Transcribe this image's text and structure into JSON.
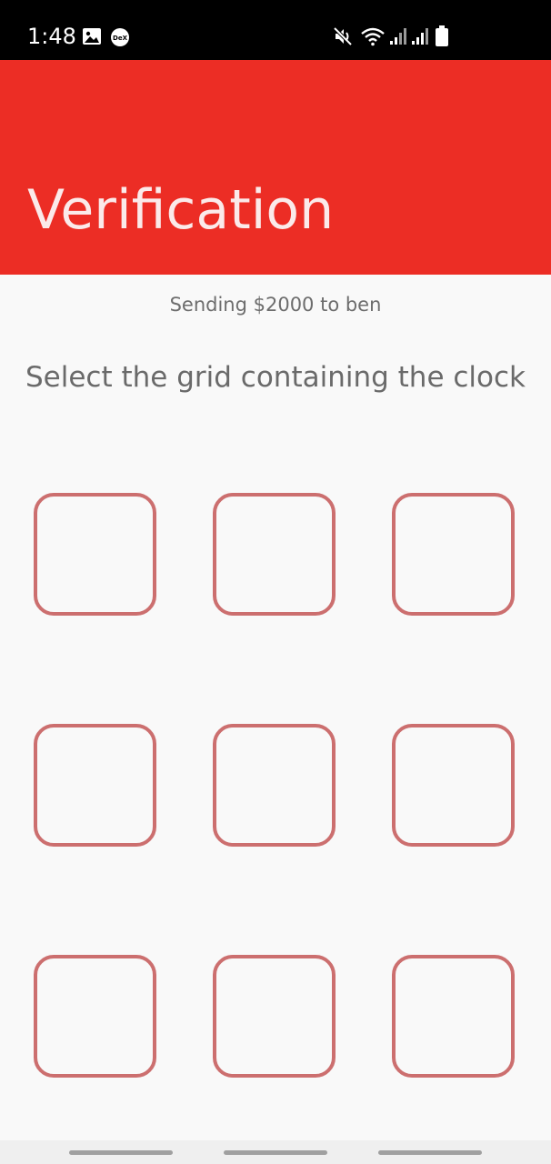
{
  "status_bar": {
    "time": "1:48",
    "icons": [
      "image-icon",
      "dex-icon",
      "mute-icon",
      "wifi-icon",
      "signal-icon",
      "signal-icon",
      "battery-icon"
    ],
    "dex_label": "DeX"
  },
  "header": {
    "title": "Verification",
    "color": "#ec2d25"
  },
  "main": {
    "subtitle": "Sending $2000 to ben",
    "instruction": "Select the grid containing the clock",
    "grid": {
      "rows": 3,
      "columns": 3,
      "cell_border_color": "#cc6f6f",
      "cells": [
        {
          "id": "cell-1-1"
        },
        {
          "id": "cell-1-2"
        },
        {
          "id": "cell-1-3"
        },
        {
          "id": "cell-2-1"
        },
        {
          "id": "cell-2-2"
        },
        {
          "id": "cell-2-3"
        },
        {
          "id": "cell-3-1"
        },
        {
          "id": "cell-3-2"
        },
        {
          "id": "cell-3-3"
        }
      ]
    }
  },
  "nav_bar": {
    "handles": [
      "recent-apps",
      "home",
      "back"
    ]
  }
}
